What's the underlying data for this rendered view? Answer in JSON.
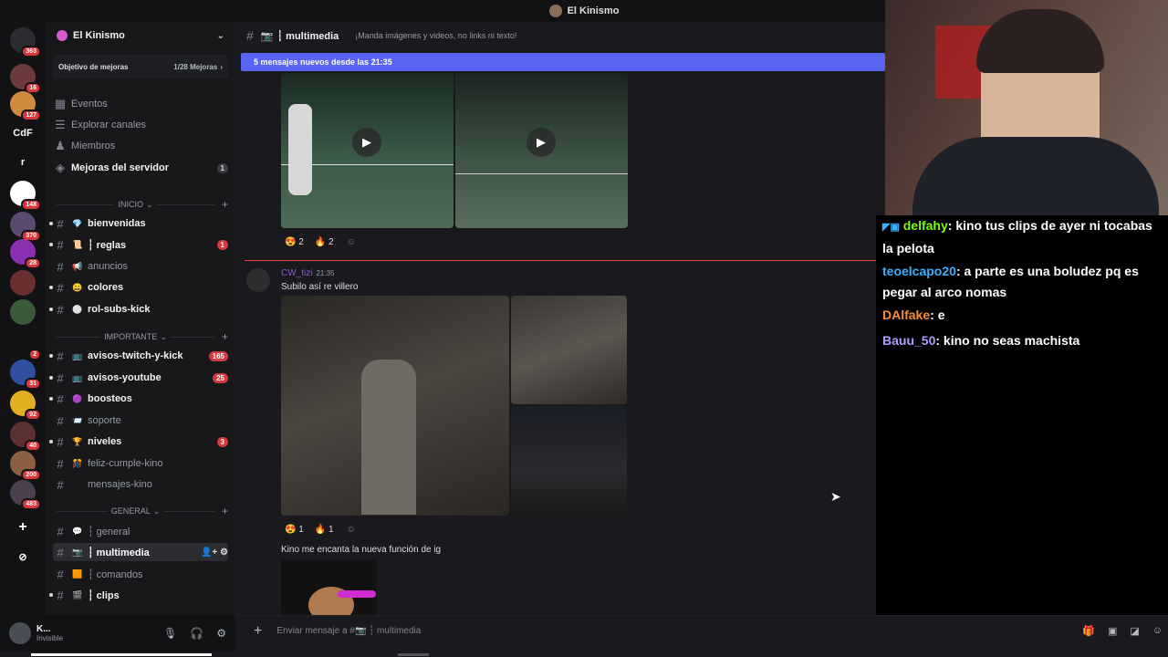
{
  "window": {
    "title": "El Kinismo"
  },
  "servers": [
    {
      "label": "",
      "badge": "363",
      "color": "#2b2d31"
    },
    {
      "label": "",
      "badge": "16",
      "color": "#6b3a3a"
    },
    {
      "label": "",
      "badge": "127",
      "color": "#d08a40"
    },
    {
      "label": "CdF",
      "badge": "",
      "color": "#121214"
    },
    {
      "label": "r",
      "badge": "",
      "color": "#121214"
    },
    {
      "label": "",
      "badge": "148",
      "color": "#ffffff"
    },
    {
      "label": "",
      "badge": "370",
      "color": "#5a4a70"
    },
    {
      "label": "",
      "badge": "28",
      "color": "#8a2fb0"
    },
    {
      "label": "",
      "badge": "",
      "color": "#6a2f2f"
    },
    {
      "label": "",
      "badge": "",
      "color": "#3a5a3a"
    },
    {
      "label": "",
      "badge": "2",
      "color": "#121214"
    },
    {
      "label": "",
      "badge": "31",
      "color": "#2f4fa0"
    },
    {
      "label": "",
      "badge": "92",
      "color": "#e0b020"
    },
    {
      "label": "",
      "badge": "40",
      "color": "#5a3030"
    },
    {
      "label": "",
      "badge": "200",
      "color": "#8a6040"
    },
    {
      "label": "",
      "badge": "483",
      "color": "#4a4050"
    }
  ],
  "sidebar": {
    "guild_name": "El Kinismo",
    "boost_goal": "Objetivo de mejoras",
    "boost_progress": "1/28 Mejoras",
    "top_items": [
      {
        "label": "Eventos",
        "icon": "calendar-icon"
      },
      {
        "label": "Explorar canales",
        "icon": "browse-icon"
      },
      {
        "label": "Miembros",
        "icon": "members-icon"
      },
      {
        "label": "Mejoras del servidor",
        "icon": "boost-icon",
        "count": "1"
      }
    ],
    "categories": {
      "inicio": "INICIO",
      "importante": "IMPORTANTE",
      "general": "GENERAL"
    },
    "channels": [
      {
        "label": "bienvenidas",
        "emoji": "💎",
        "unread": true
      },
      {
        "label": "┆ reglas",
        "emoji": "📜",
        "unread": true,
        "count": "1"
      },
      {
        "label": "anuncios",
        "emoji": "📢",
        "unread": false
      },
      {
        "label": "colores",
        "emoji": "😀",
        "unread": true
      },
      {
        "label": "rol-subs-kick",
        "emoji": "⚪",
        "unread": true
      },
      {
        "label": "avisos-twitch-y-kick",
        "emoji": "📺",
        "unread": true,
        "count": "165"
      },
      {
        "label": "avisos-youtube",
        "emoji": "📺",
        "unread": true,
        "count": "25"
      },
      {
        "label": "boosteos",
        "emoji": "🟣",
        "unread": true
      },
      {
        "label": "soporte",
        "emoji": "📨",
        "unread": false
      },
      {
        "label": "niveles",
        "emoji": "🏆",
        "unread": true,
        "count": "3"
      },
      {
        "label": "feliz-cumple-kino",
        "emoji": "🎊",
        "unread": false
      },
      {
        "label": "mensajes-kino",
        "emoji": "",
        "unread": false
      },
      {
        "label": "┆ general",
        "emoji": "💬",
        "unread": false
      },
      {
        "label": "┆ multimedia",
        "emoji": "📷",
        "active": true
      },
      {
        "label": "┆ comandos",
        "emoji": "🟧",
        "unread": false
      },
      {
        "label": "┆ clips",
        "emoji": "🎬",
        "unread": true
      }
    ]
  },
  "user": {
    "name": "K...",
    "status": "Invisible"
  },
  "channel": {
    "name": "┆ multimedia",
    "topic": "¡Manda imágenes y videos, no links ni texto!",
    "new_messages": "5 mensajes nuevos desde las 21:35"
  },
  "messages": [
    {
      "reactions": [
        {
          "emoji": "😍",
          "count": "2"
        },
        {
          "emoji": "🔥",
          "count": "2"
        }
      ]
    },
    {
      "author": "CW_tizi",
      "time": "21:35",
      "text": "Subilo así re villero",
      "reactions": [
        {
          "emoji": "😍",
          "count": "1"
        },
        {
          "emoji": "🔥",
          "count": "1"
        }
      ]
    },
    {
      "text": "Kino me encanta la nueva función de ig"
    }
  ],
  "composer": {
    "placeholder": "Enviar mensaje a #📷 ┆ multimedia"
  },
  "stream_chat": [
    {
      "user": "delfahy",
      "color": "#7cfc00",
      "text": ": kino tus clips de ayer ni tocabas la pelota"
    },
    {
      "user": "teoelcapo20",
      "color": "#3ab0ff",
      "text": ": a parte es una boludez pq es pegar al arco nomas"
    },
    {
      "user": "DAlfake",
      "color": "#ff8c30",
      "text": ": e"
    },
    {
      "user": "Bauu_50",
      "color": "#b09cff",
      "text": ": kino no seas machista"
    }
  ],
  "colors": {
    "accent": "#5865f2",
    "badge": "#da373c",
    "divider": "#f23f43"
  }
}
